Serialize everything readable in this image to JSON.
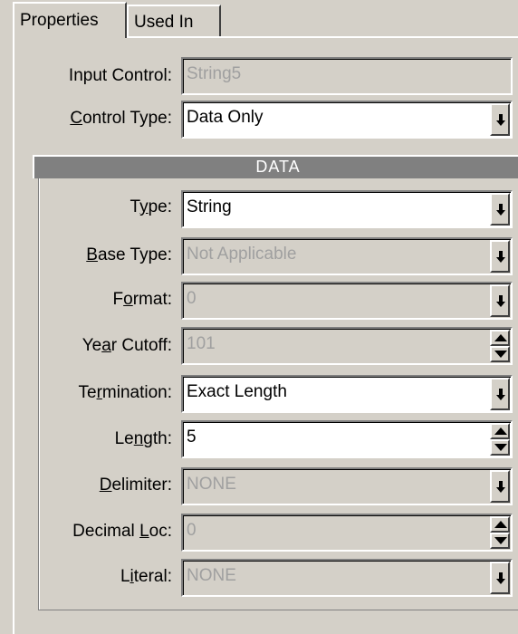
{
  "tabs": {
    "properties_label": "Properties",
    "used_in_label": "Used In"
  },
  "form": {
    "input_control": {
      "label": "Input Control:",
      "value": "String5"
    },
    "control_type": {
      "label": "Control Type:",
      "value": "Data Only"
    }
  },
  "data_section": {
    "header": "DATA",
    "type": {
      "label": "Type:",
      "value": "String"
    },
    "base_type": {
      "label": "Base Type:",
      "value": "Not Applicable"
    },
    "format": {
      "label": "Format:",
      "value": "0"
    },
    "year_cutoff": {
      "label": "Year Cutoff:",
      "value": "101"
    },
    "termination": {
      "label": "Termination:",
      "value": "Exact Length"
    },
    "length": {
      "label": "Length:",
      "value": "5"
    },
    "delimiter": {
      "label": "Delimiter:",
      "value": "NONE"
    },
    "decimal_loc": {
      "label": "Decimal Loc:",
      "value": "0"
    },
    "literal": {
      "label": "Literal:",
      "value": "NONE"
    }
  },
  "colors": {
    "dialog_bg": "#d4d0c8",
    "header_bg": "#808080",
    "disabled_text": "#a0a0a0"
  },
  "icons": {
    "dropdown": "chevron-down-icon",
    "spinner": "spinner-arrows-icon"
  }
}
